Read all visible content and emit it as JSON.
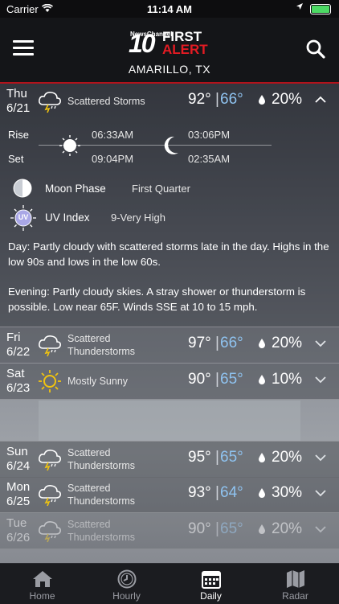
{
  "status": {
    "carrier": "Carrier",
    "time": "11:14 AM"
  },
  "header": {
    "logo_channel": "NewsChannel",
    "logo_number": "10",
    "logo_first": "FIRST",
    "logo_alert": "ALERT",
    "city": "AMARILLO, TX"
  },
  "expanded": {
    "day": "Thu",
    "date": "6/21",
    "icon": "cloud-storm-icon",
    "condition": "Scattered Storms",
    "high": "92°",
    "low": "66°",
    "precip": "20%",
    "sun": {
      "rise_label": "Rise",
      "set_label": "Set",
      "sunrise": "06:33AM",
      "sunset": "09:04PM"
    },
    "moon": {
      "moonrise": "03:06PM",
      "moonset": "02:35AM"
    },
    "moon_phase_label": "Moon Phase",
    "moon_phase": "First Quarter",
    "uv_label": "UV Index",
    "uv_value": "9-Very High",
    "uv_icon_text": "UV",
    "day_label": "Day",
    "day_text": ": Partly cloudy with scattered storms late in the day. Highs in the low 90s and lows in the low 60s.",
    "evening_label": "Evening",
    "evening_text": ": Partly cloudy skies. A stray shower or thunderstorm is possible. Low near 65F. Winds SSE at 10 to 15 mph."
  },
  "forecast": [
    {
      "day": "Fri",
      "date": "6/22",
      "icon": "cloud-storm-icon",
      "cond1": "Scattered",
      "cond2": "Thunderstorms",
      "high": "97°",
      "low": "66°",
      "precip": "20%"
    },
    {
      "day": "Sat",
      "date": "6/23",
      "icon": "sun-icon",
      "cond1": "Mostly Sunny",
      "cond2": "",
      "high": "90°",
      "low": "65°",
      "precip": "10%"
    },
    {
      "day": "Sun",
      "date": "6/24",
      "icon": "cloud-storm-icon",
      "cond1": "Scattered",
      "cond2": "Thunderstorms",
      "high": "95°",
      "low": "65°",
      "precip": "20%"
    },
    {
      "day": "Mon",
      "date": "6/25",
      "icon": "cloud-storm-icon",
      "cond1": "Scattered",
      "cond2": "Thunderstorms",
      "high": "93°",
      "low": "64°",
      "precip": "30%"
    },
    {
      "day": "Tue",
      "date": "6/26",
      "icon": "cloud-storm-icon",
      "cond1": "Scattered",
      "cond2": "Thunderstorms",
      "high": "90°",
      "low": "65°",
      "precip": "20%"
    }
  ],
  "tabs": [
    {
      "label": "Home",
      "icon": "home-icon"
    },
    {
      "label": "Hourly",
      "icon": "clock-icon"
    },
    {
      "label": "Daily",
      "icon": "calendar-icon"
    },
    {
      "label": "Radar",
      "icon": "map-icon"
    }
  ],
  "colors": {
    "accent_red": "#b3121b",
    "low_temp_blue": "#8fc3f0",
    "uv_purple": "#a9a7e6"
  }
}
